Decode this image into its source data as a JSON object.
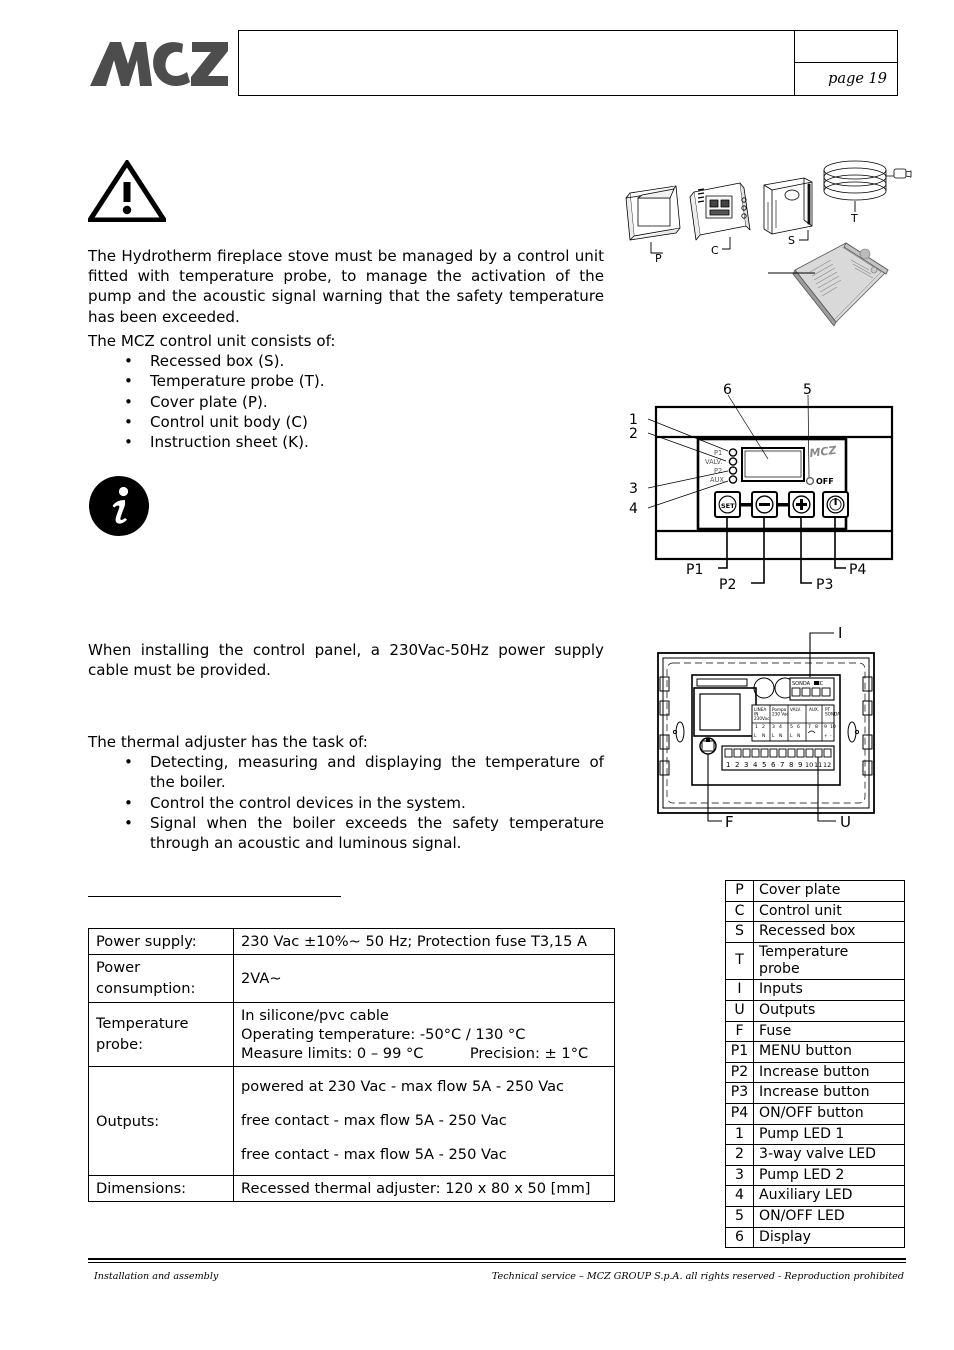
{
  "header": {
    "logo_text": "MCZ",
    "page_label": "page 19"
  },
  "content": {
    "warning_icon": "warning-triangle-icon",
    "info_icon": "information-icon",
    "intro_paragraph": "The Hydrotherm fireplace stove must be managed by a control unit fitted with temperature probe, to manage the activation of the pump and the acoustic signal warning that the safety temperature has been exceeded.",
    "consists_heading": "The MCZ control unit consists of:",
    "consists_items": [
      "Recessed box (S).",
      "Temperature probe (T).",
      "Cover plate (P).",
      "Control unit body (C)",
      "Instruction sheet (K)."
    ],
    "power_note": "When installing the control panel, a 230Vac-50Hz power supply cable must be provided.",
    "task_heading": "The thermal adjuster has the task of:",
    "task_items": [
      "Detecting, measuring and displaying the temperature of the boiler.",
      "Control the control devices in the system.",
      "Signal when the boiler exceeds the safety temperature through an acoustic and luminous signal."
    ]
  },
  "spec_table": {
    "rows": [
      {
        "key": "Power supply:",
        "values": [
          "230 Vac ±10%~ 50 Hz; Protection fuse T3,15 A"
        ]
      },
      {
        "key": "Power consumption:",
        "values": [
          "2VA~"
        ]
      },
      {
        "key": "Temperature probe:",
        "values": [
          "In silicone/pvc cable",
          "Operating temperature: -50°C / 130 °C",
          "Measure limits: 0 – 99 °C          Precision: ± 1°C"
        ]
      },
      {
        "key": "Outputs:",
        "values": [
          "powered at 230 Vac - max flow 5A - 250 Vac",
          "free contact - max flow 5A - 250 Vac",
          "free contact - max flow 5A - 250 Vac"
        ]
      },
      {
        "key": "Dimensions:",
        "values": [
          "Recessed thermal adjuster: 120 x 80 x 50 [mm]"
        ]
      }
    ]
  },
  "legend_table": {
    "rows": [
      {
        "key": "P",
        "label": "Cover plate"
      },
      {
        "key": "C",
        "label": "Control unit"
      },
      {
        "key": "S",
        "label": "Recessed box"
      },
      {
        "key": "T",
        "label": "Temperature probe"
      },
      {
        "key": "I",
        "label": "Inputs"
      },
      {
        "key": "U",
        "label": "Outputs"
      },
      {
        "key": "F",
        "label": "Fuse"
      },
      {
        "key": "P1",
        "label": "MENU button"
      },
      {
        "key": "P2",
        "label": "Increase button"
      },
      {
        "key": "P3",
        "label": "Increase button"
      },
      {
        "key": "P4",
        "label": "ON/OFF button"
      },
      {
        "key": "1",
        "label": "Pump LED 1"
      },
      {
        "key": "2",
        "label": "3-way valve LED"
      },
      {
        "key": "3",
        "label": "Pump LED 2"
      },
      {
        "key": "4",
        "label": "Auxiliary LED"
      },
      {
        "key": "5",
        "label": "ON/OFF LED"
      },
      {
        "key": "6",
        "label": "Display"
      }
    ]
  },
  "figures": {
    "exploded": {
      "name": "exploded-assembly-diagram",
      "callouts": [
        "P",
        "C",
        "S",
        "T"
      ]
    },
    "panel": {
      "name": "control-panel-front-diagram",
      "callouts_top": [
        "6",
        "5"
      ],
      "callouts_left": [
        "1",
        "2",
        "3",
        "4"
      ],
      "callouts_bottom": [
        "P1",
        "P2",
        "P3",
        "P4"
      ],
      "led_labels": [
        "P1",
        "VALVE",
        "P2",
        "AUX"
      ],
      "onoff_label": "OFF",
      "brand": "MCZ"
    },
    "board": {
      "name": "recessed-unit-board-diagram",
      "callouts": [
        "I",
        "F",
        "U"
      ],
      "terminal_numbers": [
        "1",
        "2",
        "3",
        "4",
        "5",
        "6",
        "7",
        "8",
        "9",
        "10",
        "11",
        "12"
      ],
      "block_labels": [
        "LINEA IN 230Vac",
        "Pompa 230 Vac",
        "VALV.",
        "AUX.",
        "PT SONDA"
      ]
    }
  },
  "footer": {
    "left": "Installation and assembly",
    "right": "Technical service – MCZ GROUP S.p.A. all rights reserved - Reproduction prohibited"
  }
}
